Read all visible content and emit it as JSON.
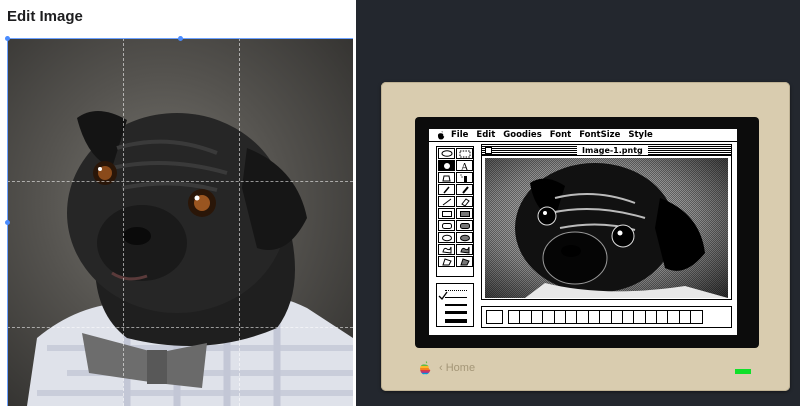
{
  "editor": {
    "title": "Edit Image"
  },
  "mac": {
    "menu": [
      "File",
      "Edit",
      "Goodies",
      "Font",
      "FontSize",
      "Style"
    ],
    "document_title": "Image-1.pntg",
    "tools": [
      "lasso",
      "marquee",
      "grabber-hand",
      "text",
      "paint-bucket",
      "spray-can",
      "paintbrush",
      "pencil",
      "line",
      "eraser",
      "rectangle",
      "filled-rectangle",
      "rounded-rectangle",
      "filled-rounded-rectangle",
      "oval",
      "filled-oval",
      "freeform",
      "filled-freeform",
      "polygon",
      "filled-polygon"
    ],
    "pattern_count": 17
  },
  "footer": {
    "home_label": "‹ Home"
  },
  "colors": {
    "dark_background": "#23272e",
    "monitor_beige": "#d9ccaf",
    "power_led": "#10e02a",
    "home_text": "#a49677",
    "crop_accent": "#4a8cff"
  }
}
